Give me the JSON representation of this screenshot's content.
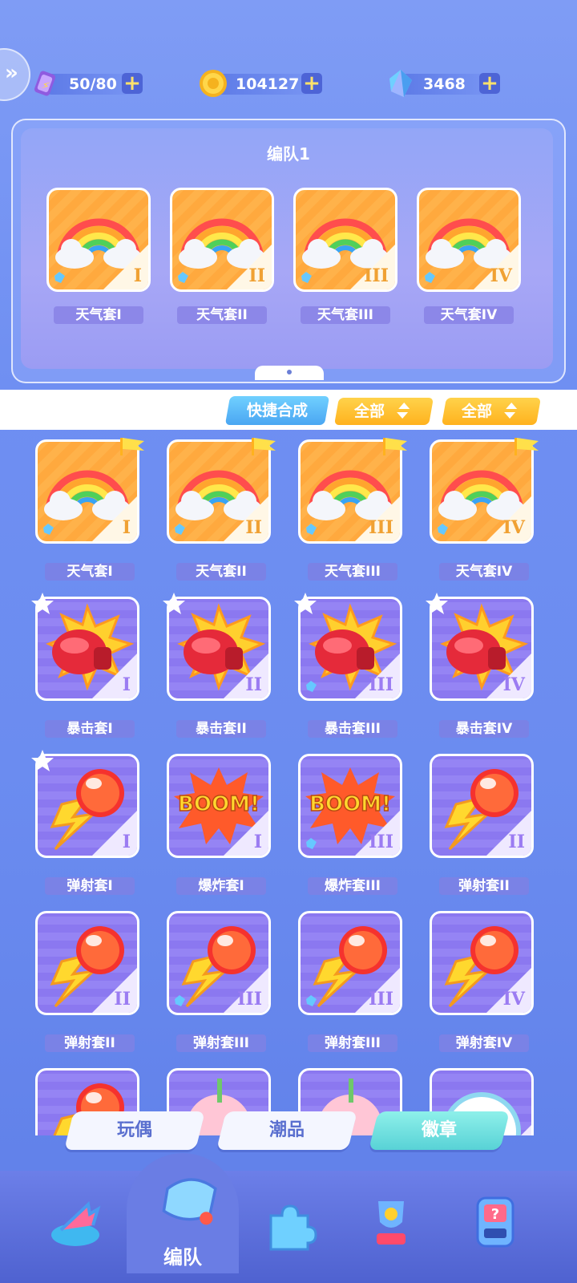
{
  "currencies": [
    {
      "name": "stamina",
      "value": "50/80",
      "icon": "ticket-icon"
    },
    {
      "name": "coins",
      "value": "104127",
      "icon": "coin-icon"
    },
    {
      "name": "gems",
      "value": "3468",
      "icon": "crystal-icon"
    }
  ],
  "team": {
    "title": "编队1",
    "slots": [
      {
        "label": "天气套I",
        "roman": "I",
        "theme": "rainbow"
      },
      {
        "label": "天气套II",
        "roman": "II",
        "theme": "rainbow"
      },
      {
        "label": "天气套III",
        "roman": "III",
        "theme": "rainbow"
      },
      {
        "label": "天气套IV",
        "roman": "IV",
        "theme": "rainbow"
      }
    ]
  },
  "toolbar": {
    "quick_merge": "快捷合成",
    "filter1": "全部",
    "filter2": "全部"
  },
  "grid": [
    {
      "label": "天气套I",
      "roman": "I",
      "theme": "rainbow",
      "badge": "flag"
    },
    {
      "label": "天气套II",
      "roman": "II",
      "theme": "rainbow",
      "badge": "flag"
    },
    {
      "label": "天气套III",
      "roman": "III",
      "theme": "rainbow",
      "badge": "flag"
    },
    {
      "label": "天气套IV",
      "roman": "IV",
      "theme": "rainbow",
      "badge": "flag"
    },
    {
      "label": "暴击套I",
      "roman": "I",
      "theme": "glove",
      "badge": "star"
    },
    {
      "label": "暴击套II",
      "roman": "II",
      "theme": "glove",
      "badge": "star"
    },
    {
      "label": "暴击套III",
      "roman": "III",
      "theme": "glove",
      "badge": "star"
    },
    {
      "label": "暴击套IV",
      "roman": "IV",
      "theme": "glove",
      "badge": "star"
    },
    {
      "label": "弹射套I",
      "roman": "I",
      "theme": "ball",
      "badge": "star"
    },
    {
      "label": "爆炸套I",
      "roman": "I",
      "theme": "boom",
      "badge": ""
    },
    {
      "label": "爆炸套III",
      "roman": "III",
      "theme": "boom",
      "badge": ""
    },
    {
      "label": "弹射套II",
      "roman": "II",
      "theme": "ball",
      "badge": ""
    },
    {
      "label": "弹射套II",
      "roman": "II",
      "theme": "ball",
      "badge": ""
    },
    {
      "label": "弹射套III",
      "roman": "III",
      "theme": "ball",
      "badge": ""
    },
    {
      "label": "弹射套III",
      "roman": "III",
      "theme": "ball",
      "badge": ""
    },
    {
      "label": "弹射套IV",
      "roman": "IV",
      "theme": "ball",
      "badge": ""
    },
    {
      "label": "",
      "roman": "",
      "theme": "ball",
      "badge": ""
    },
    {
      "label": "",
      "roman": "",
      "theme": "drink",
      "badge": ""
    },
    {
      "label": "",
      "roman": "",
      "theme": "drink",
      "badge": ""
    },
    {
      "label": "",
      "roman": "",
      "theme": "gauge",
      "badge": ""
    }
  ],
  "boom_text": "BOOM!",
  "tabs": [
    {
      "label": "玩偶",
      "active": false
    },
    {
      "label": "潮品",
      "active": false
    },
    {
      "label": "徽章",
      "active": true
    }
  ],
  "nav": {
    "active_label": "编队",
    "icons": [
      "home-arrow-icon",
      "whistle-icon",
      "puzzle-icon",
      "trophy-icon",
      "mystery-machine-icon"
    ]
  },
  "colors": {
    "accent": "#58d2d6",
    "orange_card": "#ffb24a",
    "purple_card": "#8b78f0",
    "gold": "#ffc21e"
  }
}
